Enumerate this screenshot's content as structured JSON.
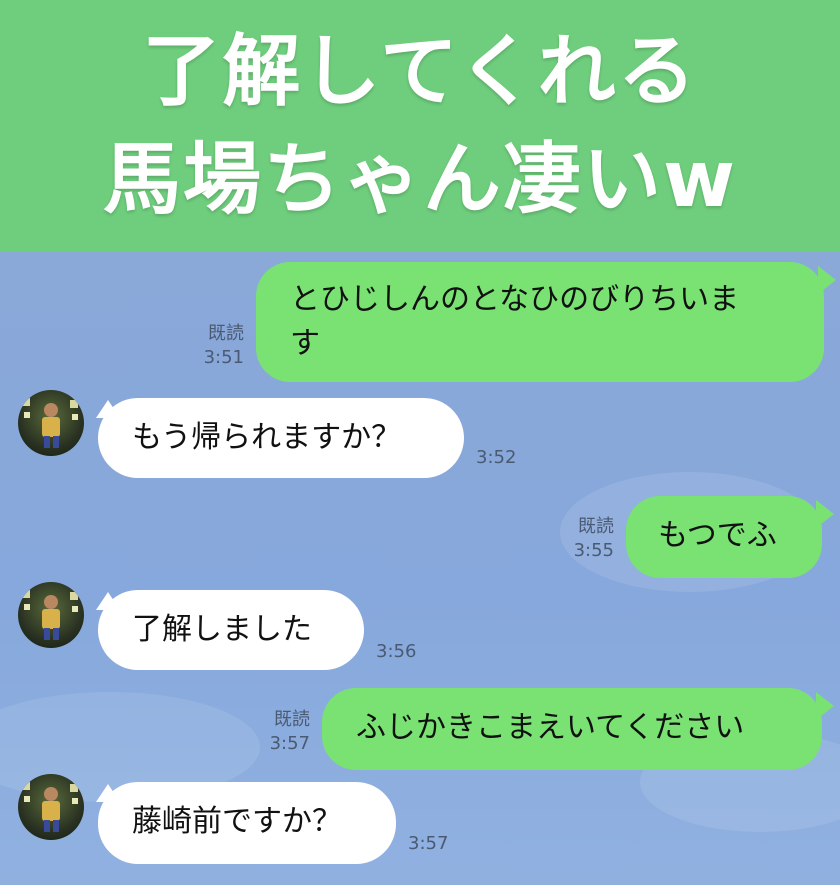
{
  "banner": {
    "line1": "了解してくれる",
    "line2": "馬場ちゃん凄いw"
  },
  "messages": [
    {
      "side": "sent",
      "text_line1": "とひじしんのとなひのびりちいま",
      "text_line2": "す",
      "read": "既読",
      "time": "3:51"
    },
    {
      "side": "recv",
      "text": "もう帰られますか？",
      "time": "3:52",
      "avatar_icon": "contact-avatar"
    },
    {
      "side": "sent",
      "text": "もつでふ",
      "read": "既読",
      "time": "3:55"
    },
    {
      "side": "recv",
      "text": "了解しました",
      "time": "3:56",
      "avatar_icon": "contact-avatar"
    },
    {
      "side": "sent",
      "text": "ふじかきこまえいてください",
      "read": "既読",
      "time": "3:57"
    },
    {
      "side": "recv",
      "text": "藤崎前ですか？",
      "time": "3:57",
      "avatar_icon": "contact-avatar"
    }
  ],
  "colors": {
    "banner": "#6fce7d",
    "chat_background": "#8aa9d8",
    "sent_bubble": "#79e273",
    "received_bubble": "#ffffff"
  }
}
